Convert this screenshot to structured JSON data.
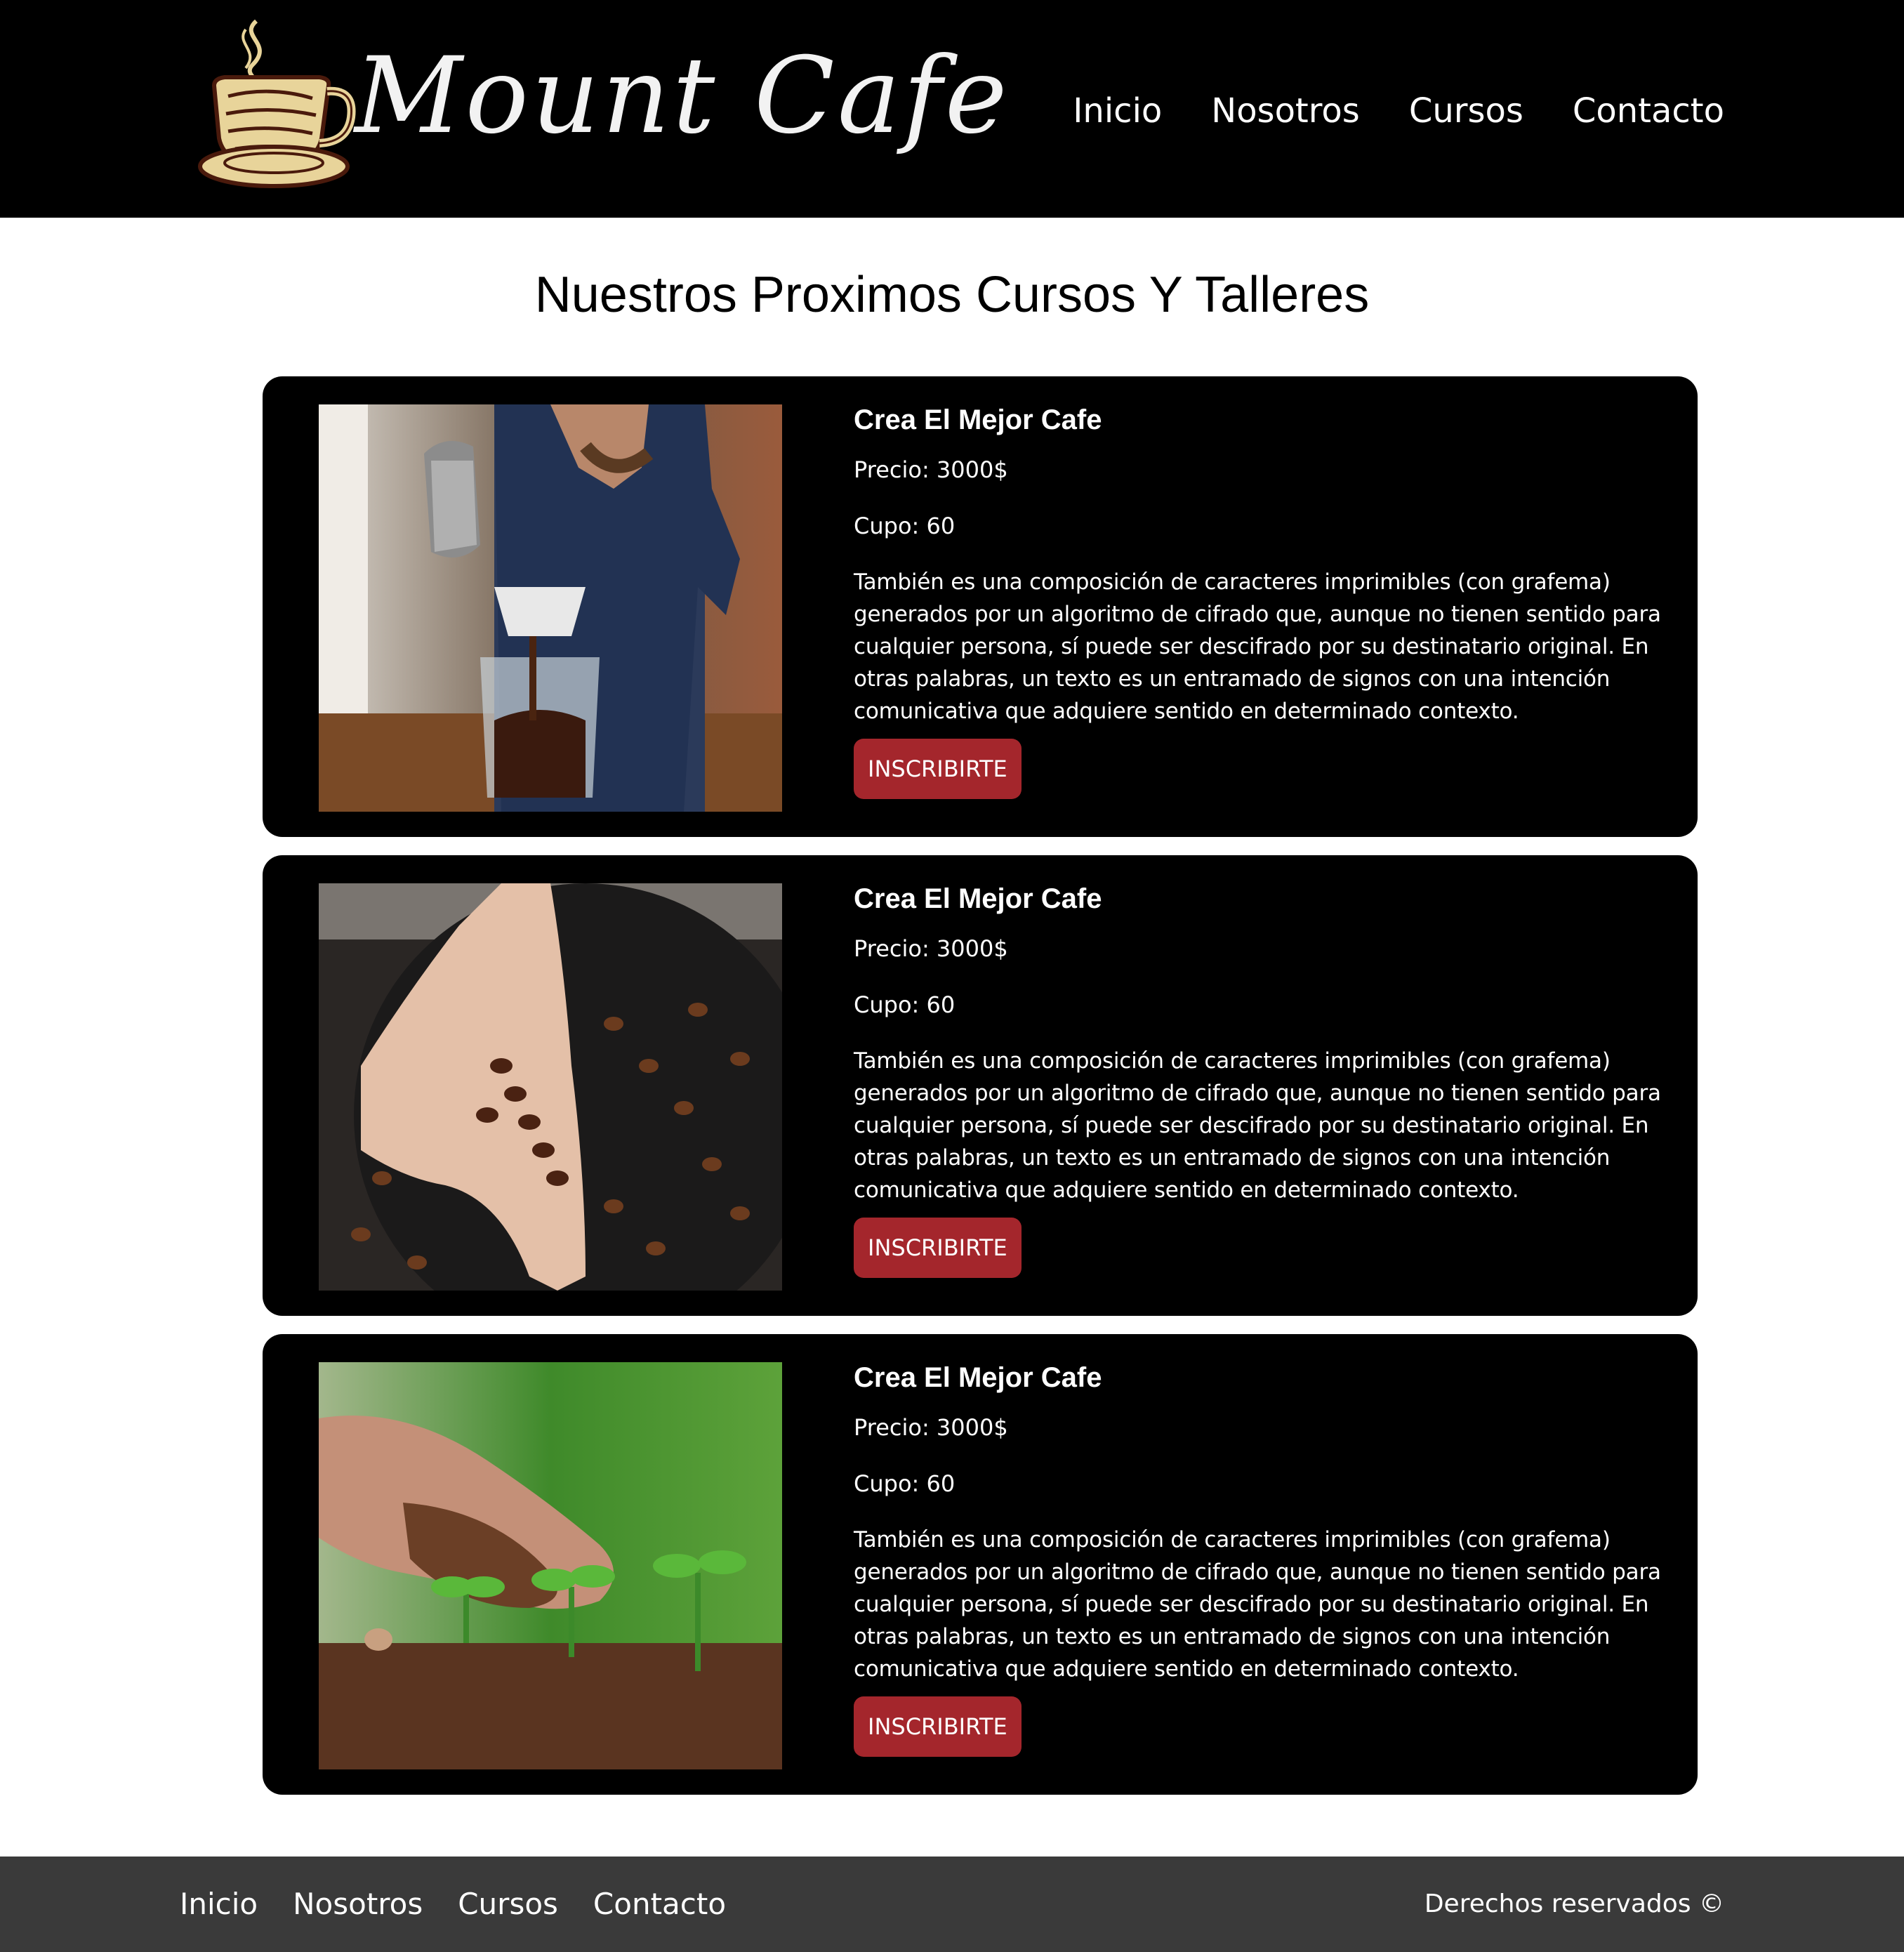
{
  "header": {
    "logo_text": "Mount Cafe",
    "nav": [
      "Inicio",
      "Nosotros",
      "Cursos",
      "Contacto"
    ]
  },
  "main": {
    "title": "Nuestros Proximos Cursos Y Talleres",
    "courses": [
      {
        "title": "Crea El Mejor Cafe",
        "price": "Precio: 3000$",
        "capacity": "Cupo: 60",
        "description": "También es una composición de caracteres imprimibles (con grafema) generados por un algoritmo de cifrado que, aunque no tienen sentido para cualquier persona, sí puede ser descifrado por su destinatario original. En otras palabras, un texto es un entramado de signos con una intención comunicativa que adquiere sentido en determinado contexto.",
        "button": "INSCRIBIRTE",
        "image": "barista-pouring-coffee-photo"
      },
      {
        "title": "Crea El Mejor Cafe",
        "price": "Precio: 3000$",
        "capacity": "Cupo: 60",
        "description": "También es una composición de caracteres imprimibles (con grafema) generados por un algoritmo de cifrado que, aunque no tienen sentido para cualquier persona, sí puede ser descifrado por su destinatario original. En otras palabras, un texto es un entramado de signos con una intención comunicativa que adquiere sentido en determinado contexto.",
        "button": "INSCRIBIRTE",
        "image": "hand-with-coffee-beans-photo"
      },
      {
        "title": "Crea El Mejor Cafe",
        "price": "Precio: 3000$",
        "capacity": "Cupo: 60",
        "description": "También es una composición de caracteres imprimibles (con grafema) generados por un algoritmo de cifrado que, aunque no tienen sentido para cualquier persona, sí puede ser descifrado por su destinatario original. En otras palabras, un texto es un entramado de signos con una intención comunicativa que adquiere sentido en determinado contexto.",
        "button": "INSCRIBIRTE",
        "image": "hand-with-soil-and-seedlings-photo"
      }
    ]
  },
  "footer": {
    "nav": [
      "Inicio",
      "Nosotros",
      "Cursos",
      "Contacto"
    ],
    "copyright": "Derechos reservados ©"
  },
  "colors": {
    "header_bg": "#000000",
    "card_bg": "#000000",
    "button_bg": "#a4262c",
    "footer_bg": "#3a3a3a",
    "logo_cup": "#e8d49a"
  }
}
